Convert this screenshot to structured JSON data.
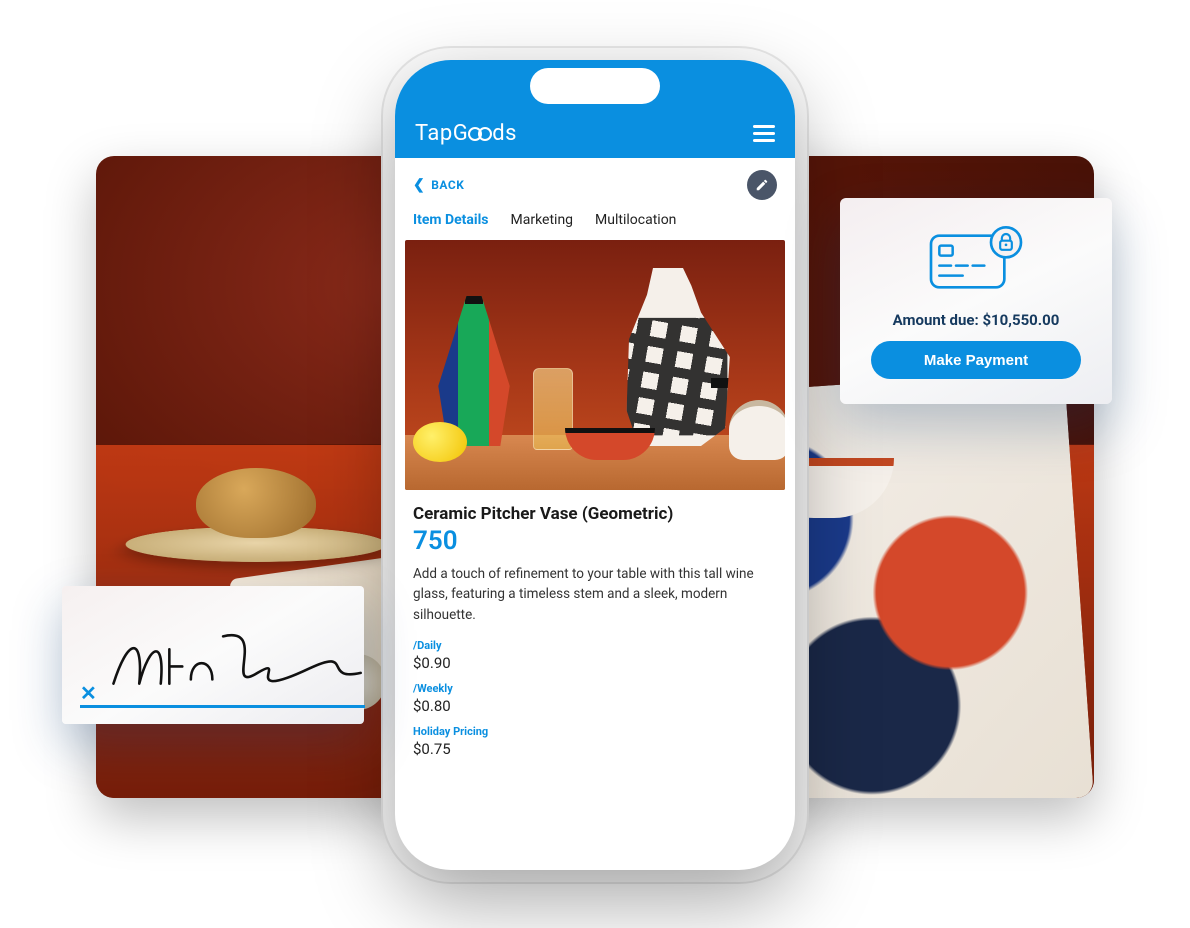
{
  "background": {
    "alt": "Table setting with bread, vases, bowl, and patterned fabric"
  },
  "phone": {
    "brand_prefix": "TapG",
    "brand_suffix": "ds",
    "back_label": "BACK",
    "tabs": [
      {
        "label": "Item Details",
        "active": true
      },
      {
        "label": "Marketing",
        "active": false
      },
      {
        "label": "Multilocation",
        "active": false
      }
    ],
    "product": {
      "title": "Ceramic Pitcher Vase (Geometric)",
      "quantity": "750",
      "description": "Add a touch of refinement to your table with this tall wine glass, featuring a timeless stem and a sleek, modern silhouette.",
      "pricing": [
        {
          "label": "/Daily",
          "value": "$0.90"
        },
        {
          "label": "/Weekly",
          "value": "$0.80"
        },
        {
          "label": "Holiday Pricing",
          "value": "$0.75"
        }
      ]
    }
  },
  "signature": {
    "marker": "✕"
  },
  "payment": {
    "amount_label": "Amount due: $10,550.00",
    "button_label": "Make Payment"
  },
  "colors": {
    "accent": "#0a8fe0",
    "heading": "#163a5f"
  }
}
